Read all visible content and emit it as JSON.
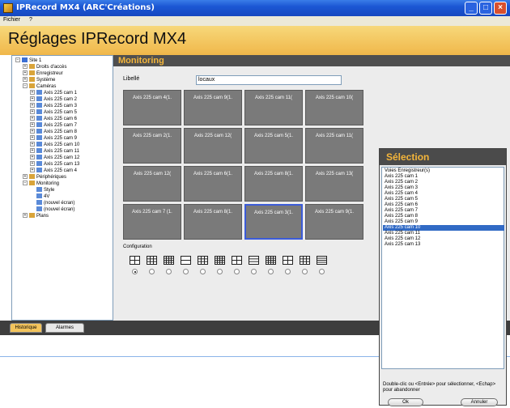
{
  "window": {
    "title": "IPRecord MX4 (ARC'Créations)"
  },
  "menu": {
    "file": "Fichier",
    "help": "?"
  },
  "header": {
    "title": "Réglages IPRecord MX4"
  },
  "tree": {
    "items": [
      {
        "label": "Site 1",
        "level": 0,
        "exp": "−"
      },
      {
        "label": "Droits d'accès",
        "level": 1,
        "exp": "+"
      },
      {
        "label": "Enregistreur",
        "level": 1,
        "exp": "+"
      },
      {
        "label": "Système",
        "level": 1,
        "exp": "+"
      },
      {
        "label": "Caméras",
        "level": 1,
        "exp": "−"
      },
      {
        "label": "Axis 225 cam 1",
        "level": 2,
        "exp": "+"
      },
      {
        "label": "Axis 225 cam 2",
        "level": 2,
        "exp": "+"
      },
      {
        "label": "Axis 225 cam 3",
        "level": 2,
        "exp": "+"
      },
      {
        "label": "Axis 225 cam 5",
        "level": 2,
        "exp": "+"
      },
      {
        "label": "Axis 225 cam 6",
        "level": 2,
        "exp": "+"
      },
      {
        "label": "Axis 225 cam 7",
        "level": 2,
        "exp": "+"
      },
      {
        "label": "Axis 225 cam 8",
        "level": 2,
        "exp": "+"
      },
      {
        "label": "Axis 225 cam 9",
        "level": 2,
        "exp": "+"
      },
      {
        "label": "Axis 225 cam 10",
        "level": 2,
        "exp": "+"
      },
      {
        "label": "Axis 225 cam 11",
        "level": 2,
        "exp": "+"
      },
      {
        "label": "Axis 225 cam 12",
        "level": 2,
        "exp": "+"
      },
      {
        "label": "Axis 225 cam 13",
        "level": 2,
        "exp": "+"
      },
      {
        "label": "Axis 225 cam 4",
        "level": 2,
        "exp": "+"
      },
      {
        "label": "Périphériques",
        "level": 1,
        "exp": "+"
      },
      {
        "label": "Monitoring",
        "level": 1,
        "exp": "−"
      },
      {
        "label": "Style",
        "level": 2,
        "exp": ""
      },
      {
        "label": "4V",
        "level": 2,
        "exp": ""
      },
      {
        "label": "(nouvel écran)",
        "level": 2,
        "exp": ""
      },
      {
        "label": "(nouvel écran)",
        "level": 2,
        "exp": ""
      },
      {
        "label": "Plans",
        "level": 1,
        "exp": "+"
      }
    ]
  },
  "main": {
    "section_title": "Monitoring",
    "libelle_label": "Libellé",
    "libelle_value": "locaux",
    "grid": [
      "Axis 225 cam 4(1.",
      "Axis 225 cam 9(1.",
      "Axis 225 cam 11(",
      "Axis 225 cam 10(",
      "Axis 225 cam 2(1.",
      "Axis 225 cam 12(",
      "Axis 225 cam 5(1.",
      "Axis 225 cam 11(",
      "Axis 225 cam 12(",
      "Axis 225 cam 6(1.",
      "Axis 225 cam 8(1.",
      "Axis 225 cam 13(",
      "Axis 225 cam 7 (1.",
      "Axis 225 cam 8(1.",
      "Axis 225 cam 3(1.",
      "Axis 225 cam 9(1."
    ],
    "active_cell": 14,
    "config_label": "Configuration",
    "layouts": [
      "4x4",
      "3x3",
      "2x2",
      "1+5",
      "1+2",
      "1x1",
      "1+12",
      "1+7",
      "2x1",
      "1+3",
      "3+4",
      "wide"
    ],
    "selected_layout": 0
  },
  "bottom": {
    "tab_history": "Historique",
    "tab_alarms": "Alarmes"
  },
  "dialog": {
    "title": "Sélection",
    "items": [
      "Voies Enregistreur(s)",
      "Axis 225 cam 1",
      "Axis 225 cam 2",
      "Axis 225 cam 3",
      "Axis 225 cam 4",
      "Axis 225 cam 5",
      "Axis 225 cam 6",
      "Axis 225 cam 7",
      "Axis 225 cam 8",
      "Axis 225 cam 9",
      "Axis 225 cam 10",
      "Axis 225 cam 11",
      "Axis 225 cam 12",
      "Axis 225 cam 13"
    ],
    "selected_index": 10,
    "help_text": "Double-clic ou <Entrée> pour sélectionner, <Echap> pour abandonner",
    "ok_label": "Ok",
    "cancel_label": "Annuler"
  }
}
